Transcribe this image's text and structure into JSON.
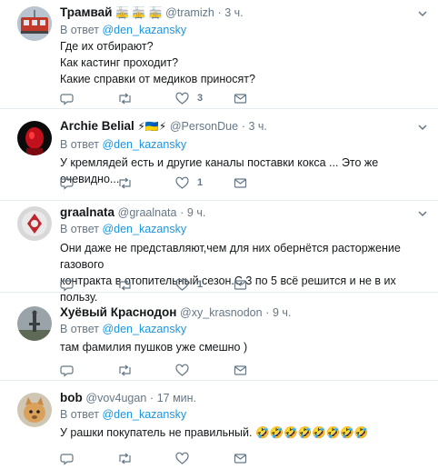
{
  "tweets": [
    {
      "name": "Трамвай",
      "emoji": "🚋 🚋 🚋",
      "handle": "@tramizh",
      "sep": "·",
      "time": "3 ч.",
      "reply_prefix": "В ответ",
      "reply_to": "@den_kazansky",
      "text": "Где их отбирают?\nКак кастинг проходит?\nКакие справки от медиков приносят?",
      "like_count": "3"
    },
    {
      "name": "Archie Belial",
      "emoji": "⚡🇺🇦⚡",
      "handle": "@PersonDue",
      "sep": "·",
      "time": "3 ч.",
      "reply_prefix": "В ответ",
      "reply_to": "@den_kazansky",
      "text": "У кремлядей есть и другие каналы поставки кокса ... Это же очевидно...",
      "like_count": "1"
    },
    {
      "name": "graalnata",
      "emoji": "",
      "handle": "@graalnata",
      "sep": "·",
      "time": "9 ч.",
      "reply_prefix": "В ответ",
      "reply_to": "@den_kazansky",
      "text": "Они даже не представляют,чем для них обернётся расторжение газового\nконтракта в отопительный сезон.С 3 по 5 всё решится и не в их пользу.",
      "like_count": "1"
    },
    {
      "name": "Хуёвый Краснодон",
      "emoji": "",
      "handle": "@xy_krasnodon",
      "sep": "·",
      "time": "9 ч.",
      "reply_prefix": "В ответ",
      "reply_to": "@den_kazansky",
      "text": "там фамилия пушков уже смешно )",
      "like_count": ""
    },
    {
      "name": "bob",
      "emoji": "",
      "handle": "@vov4ugan",
      "sep": "·",
      "time": "17 мин.",
      "reply_prefix": "В ответ",
      "reply_to": "@den_kazansky",
      "text": "У рашки покупатель не правильный.  🤣🤣🤣🤣🤣🤣🤣🤣",
      "like_count": ""
    }
  ],
  "colors": {
    "text": "#14171a",
    "muted": "#657786",
    "link": "#1b95e0",
    "border": "#e6ecf0"
  },
  "icons": [
    "reply-icon",
    "retweet-icon",
    "like-icon",
    "direct-message-icon",
    "chevron-down-icon"
  ]
}
